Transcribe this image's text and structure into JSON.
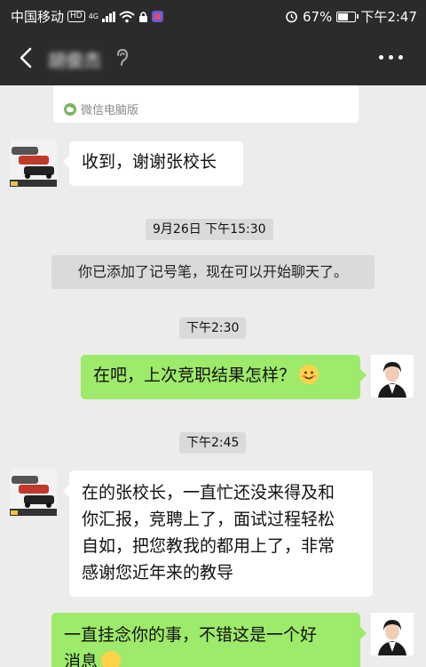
{
  "status_bar": {
    "carrier": "中国移动",
    "hd": "HD",
    "network": "4G",
    "battery": "67%",
    "time": "下午2:47"
  },
  "nav": {
    "contact_name": "胡俊杰"
  },
  "card": {
    "source": "微信电脑版"
  },
  "messages": [
    {
      "from": "contact",
      "text": "收到，谢谢张校长"
    },
    {
      "from": "system_time",
      "text": "9月26日 下午15:30"
    },
    {
      "from": "system",
      "text": "你已添加了记号笔，现在可以开始聊天了。"
    },
    {
      "from": "system_time",
      "text": "下午2:30"
    },
    {
      "from": "me",
      "text": "在吧，上次竞职结果怎样？"
    },
    {
      "from": "system_time",
      "text": "下午2:45"
    },
    {
      "from": "contact",
      "lines": [
        "在的张校长，一直忙还没来得及和",
        "你汇报，竞聘上了，面试过程轻松",
        "自如，把您教我的都用上了，非常",
        "感谢您近年来的教导"
      ]
    },
    {
      "from": "me",
      "lines": [
        "一直挂念你的事，不错这是一个好",
        "消息"
      ]
    }
  ],
  "colors": {
    "header_bg": "#2b2b2b",
    "chat_bg": "#ececec",
    "my_bubble": "#9eea6a",
    "their_bubble": "#ffffff"
  }
}
